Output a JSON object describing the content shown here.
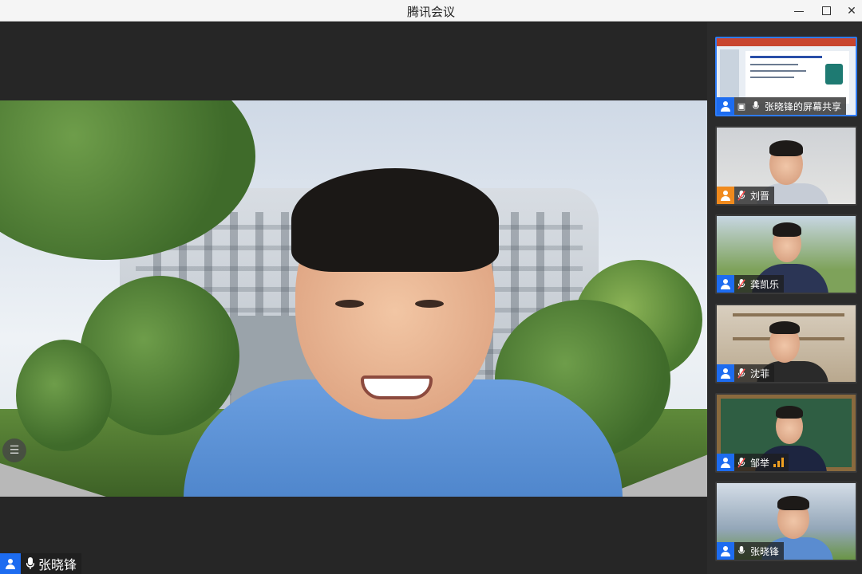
{
  "window": {
    "title": "腾讯会议",
    "controls": {
      "minimize_icon": "minimize-icon",
      "maximize_icon": "maximize-icon",
      "close_icon": "close-icon",
      "close_glyph": "✕"
    }
  },
  "main_speaker": {
    "name": "张晓锋",
    "mic_icon": "microphone-icon",
    "mic_glyph": "🎙"
  },
  "side_menu": {
    "icon": "list-menu-icon",
    "glyph": "☰"
  },
  "participants": [
    {
      "name": "张晓锋的屏幕共享",
      "type": "screen-share",
      "mic_state": "on",
      "avatar_color": "#1d6cf0"
    },
    {
      "name": "刘晋",
      "type": "video",
      "mic_state": "muted",
      "avatar_color": "#f08a1d"
    },
    {
      "name": "龚凯乐",
      "type": "video",
      "mic_state": "muted",
      "avatar_color": "#1d6cf0"
    },
    {
      "name": "沈菲",
      "type": "video",
      "mic_state": "muted",
      "avatar_color": "#1d6cf0"
    },
    {
      "name": "邹举",
      "type": "video",
      "mic_state": "muted",
      "avatar_color": "#1d6cf0",
      "speaking": true
    },
    {
      "name": "张晓锋",
      "type": "video",
      "mic_state": "on",
      "avatar_color": "#1d6cf0"
    }
  ],
  "glyphs": {
    "mic_on": "🎙",
    "mic_muted": "🎙",
    "screen_share": "▣"
  },
  "colors": {
    "accent_blue": "#1d6cf0",
    "sharing_border": "#2e7bf6",
    "muted_red": "#ff4b4b",
    "avatar_orange": "#f08a1d"
  }
}
